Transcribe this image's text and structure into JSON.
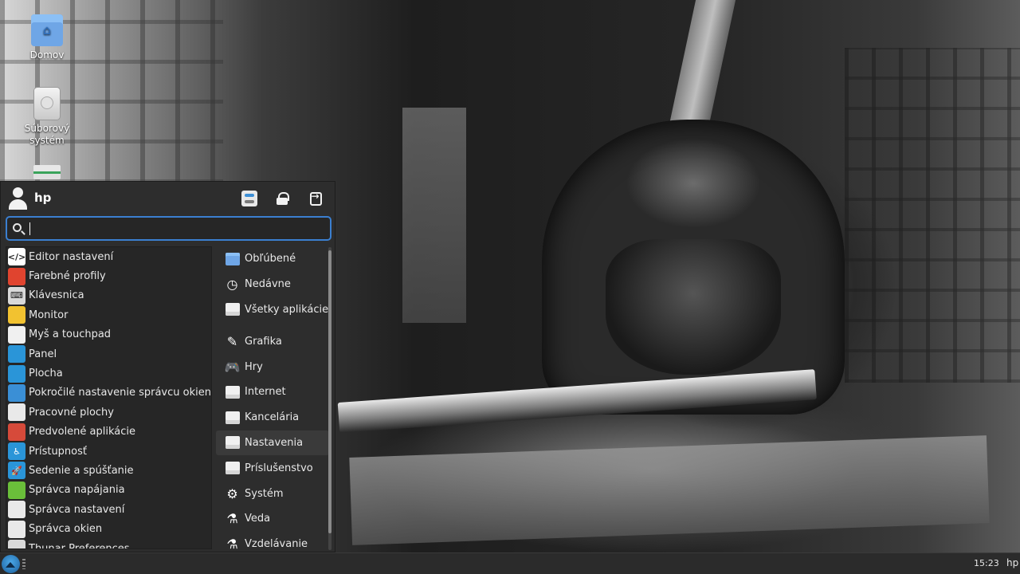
{
  "desktop": {
    "icons": [
      {
        "label": "Domov",
        "icon": "home-folder-icon"
      },
      {
        "label": "Súborový systém",
        "icon": "filesystem-drive-icon"
      },
      {
        "label": "",
        "icon": "removable-drive-icon"
      }
    ]
  },
  "menu": {
    "username": "hp",
    "header_buttons": [
      "settings-manager-icon",
      "lock-icon",
      "logout-icon"
    ],
    "search": {
      "placeholder": "",
      "value": ""
    },
    "apps": [
      {
        "label": "Editor nastavení",
        "icon": "config-editor-icon",
        "color": "#ffffff",
        "glyph": "</>"
      },
      {
        "label": "Farebné profily",
        "icon": "color-profiles-icon",
        "color": "#e0442f",
        "glyph": ""
      },
      {
        "label": "Klávesnica",
        "icon": "keyboard-icon",
        "color": "#d9d9d9",
        "glyph": "⌨"
      },
      {
        "label": "Monitor",
        "icon": "monitor-icon",
        "color": "#f2c230",
        "glyph": ""
      },
      {
        "label": "Myš a touchpad",
        "icon": "mouse-icon",
        "color": "#f0f0f0",
        "glyph": ""
      },
      {
        "label": "Panel",
        "icon": "panel-icon",
        "color": "#2a95d8",
        "glyph": ""
      },
      {
        "label": "Plocha",
        "icon": "desktop-icon",
        "color": "#2a95d8",
        "glyph": ""
      },
      {
        "label": "Pokročilé nastavenie správcu okien",
        "icon": "wm-tweaks-icon",
        "color": "#3a8fd6",
        "glyph": ""
      },
      {
        "label": "Pracovné plochy",
        "icon": "workspaces-icon",
        "color": "#e9e9e9",
        "glyph": ""
      },
      {
        "label": "Predvolené aplikácie",
        "icon": "default-apps-icon",
        "color": "#d64a3a",
        "glyph": ""
      },
      {
        "label": "Prístupnosť",
        "icon": "accessibility-icon",
        "color": "#2a95d8",
        "glyph": "♿"
      },
      {
        "label": "Sedenie a spúšťanie",
        "icon": "session-startup-icon",
        "color": "#2a95d8",
        "glyph": "🚀"
      },
      {
        "label": "Správca napájania",
        "icon": "power-manager-icon",
        "color": "#6abf3a",
        "glyph": ""
      },
      {
        "label": "Správca nastavení",
        "icon": "settings-manager-icon",
        "color": "#e9e9e9",
        "glyph": ""
      },
      {
        "label": "Správca okien",
        "icon": "window-manager-icon",
        "color": "#e9e9e9",
        "glyph": ""
      },
      {
        "label": "Thunar Preferences",
        "icon": "thunar-preferences-icon",
        "color": "#d9d9d9",
        "glyph": ""
      }
    ],
    "categories": [
      {
        "label": "Obľúbené",
        "icon": "favorites-folder-icon"
      },
      {
        "label": "Nedávne",
        "icon": "clock-icon"
      },
      {
        "label": "Všetky aplikácie",
        "icon": "all-applications-icon"
      },
      {
        "label": "Grafika",
        "icon": "graphics-icon"
      },
      {
        "label": "Hry",
        "icon": "gamepad-icon"
      },
      {
        "label": "Internet",
        "icon": "internet-icon"
      },
      {
        "label": "Kancelária",
        "icon": "office-icon"
      },
      {
        "label": "Nastavenia",
        "icon": "settings-icon",
        "active": true
      },
      {
        "label": "Príslušenstvo",
        "icon": "accessories-icon"
      },
      {
        "label": "Systém",
        "icon": "gear-icon"
      },
      {
        "label": "Veda",
        "icon": "flask-icon"
      },
      {
        "label": "Vzdelávanie",
        "icon": "flask-icon"
      }
    ]
  },
  "taskbar": {
    "clock": "15:23",
    "user": "hp"
  },
  "colors": {
    "accent": "#3b7fd0",
    "menu_bg": "#2d2d2d",
    "panel_bg": "#2b2b2b"
  }
}
